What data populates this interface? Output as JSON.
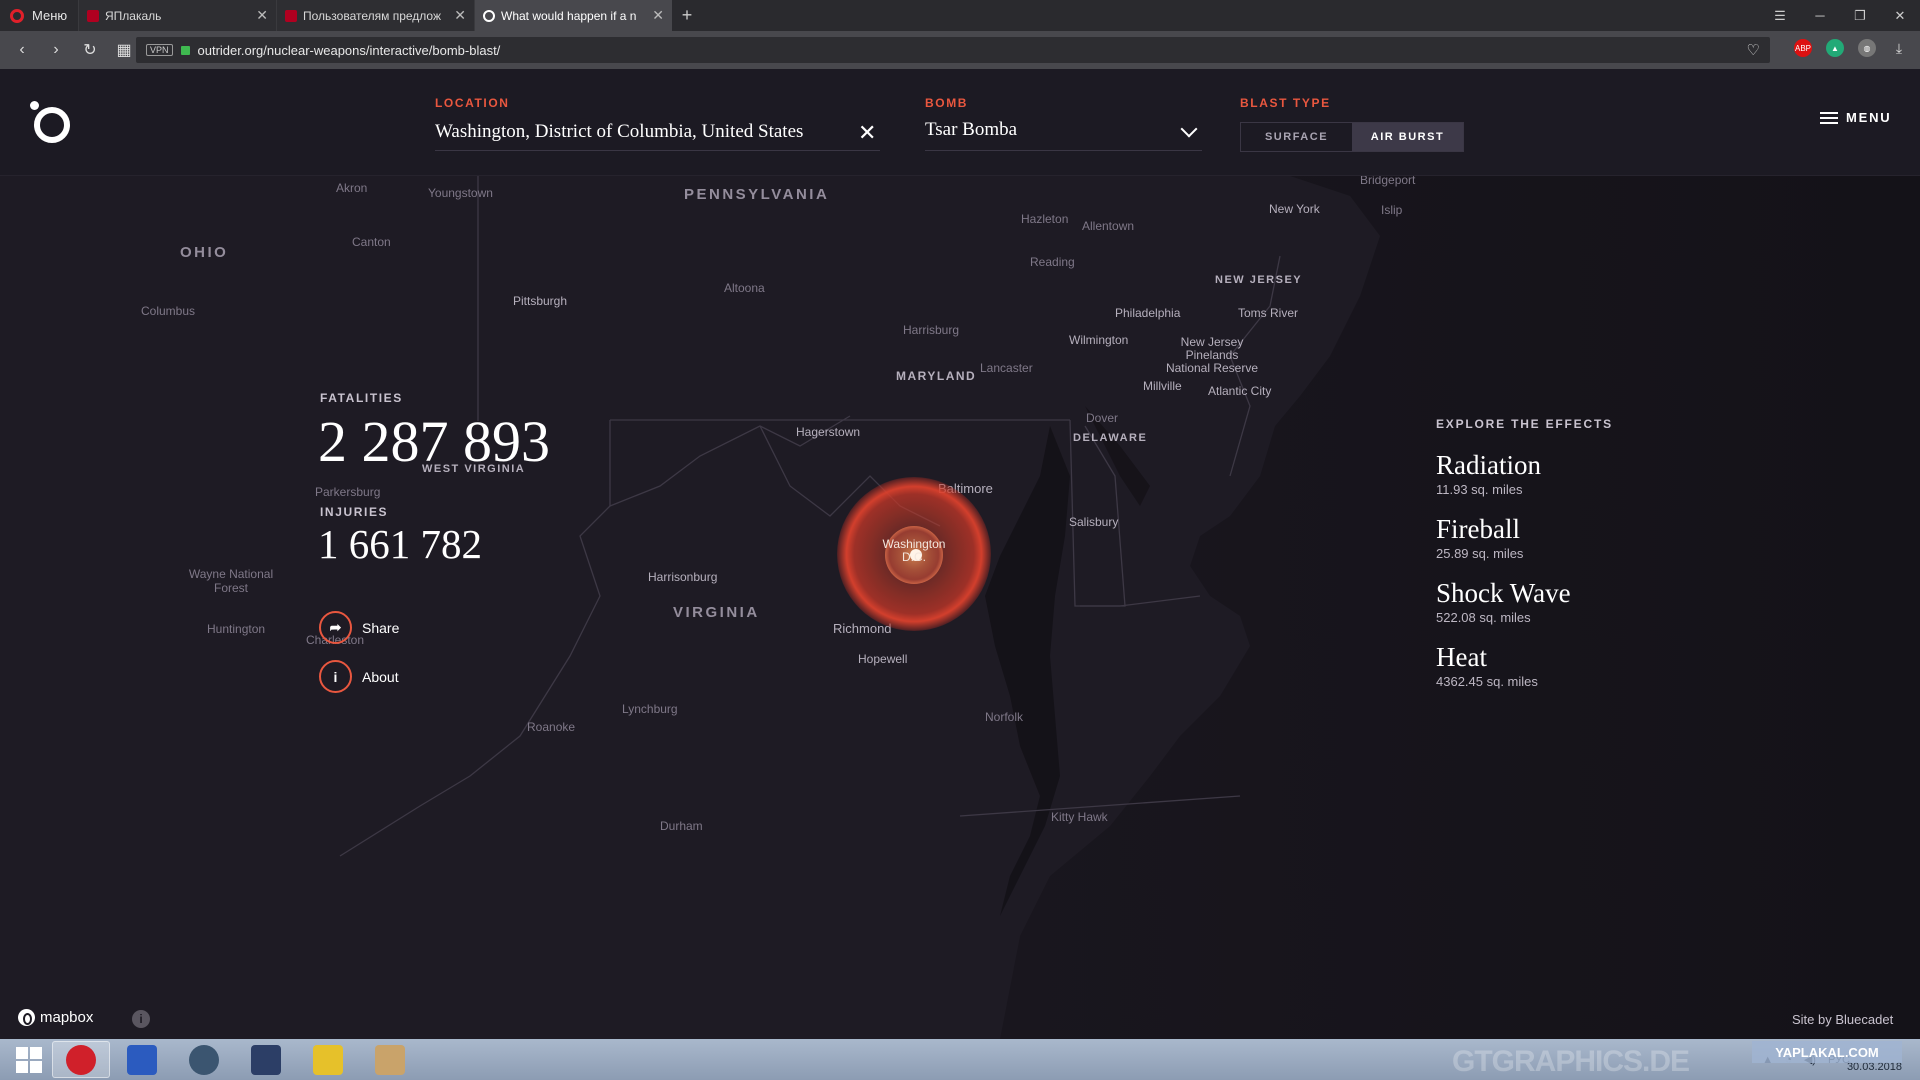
{
  "browser": {
    "menu_label": "Меню",
    "tabs": [
      {
        "title": "ЯПлакаль"
      },
      {
        "title": "Пользователям предлож"
      },
      {
        "title": "What would happen if a n"
      }
    ],
    "url": "outrider.org/nuclear-weapons/interactive/bomb-blast/",
    "vpn_label": "VPN"
  },
  "header": {
    "location_label": "LOCATION",
    "location_value": "Washington, District of Columbia, United States",
    "bomb_label": "BOMB",
    "bomb_value": "Tsar Bomba",
    "blast_type_label": "BLAST TYPE",
    "blast_surface": "SURFACE",
    "blast_air": "AIR BURST",
    "selected_blast_type": "AIR BURST",
    "menu_label": "MENU"
  },
  "stats": {
    "fatalities_label": "FATALITIES",
    "fatalities_value": "2 287 893",
    "injuries_label": "INJURIES",
    "injuries_value": "1 661 782",
    "share_label": "Share",
    "about_label": "About"
  },
  "effects": {
    "title": "EXPLORE THE EFFECTS",
    "items": [
      {
        "name": "Radiation",
        "area": "11.93 sq. miles"
      },
      {
        "name": "Fireball",
        "area": "25.89 sq. miles"
      },
      {
        "name": "Shock Wave",
        "area": "522.08 sq. miles"
      },
      {
        "name": "Heat",
        "area": "4362.45 sq. miles"
      }
    ]
  },
  "map": {
    "states": [
      "PENNSYLVANIA",
      "OHIO",
      "MARYLAND",
      "WEST VIRGINIA",
      "VIRGINIA",
      "NEW JERSEY",
      "DELAWARE"
    ],
    "places": [
      "Youngstown",
      "Akron",
      "Canton",
      "Pittsburgh",
      "Columbus",
      "Parkersburg",
      "Wayne National Forest",
      "Huntington",
      "Charleston",
      "Altoona",
      "Harrisburg",
      "Lancaster",
      "Hagerstown",
      "Baltimore",
      "Harrisonburg",
      "Lynchburg",
      "Roanoke",
      "Richmond",
      "Hopewell",
      "Norfolk",
      "Hazleton",
      "Allentown",
      "Reading",
      "Philadelphia",
      "Wilmington",
      "Dover",
      "Salisbury",
      "New York",
      "Islip",
      "Bridgeport",
      "Toms River",
      "New Jersey Pinelands National Reserve",
      "Millville",
      "Atlantic City",
      "Kitty Hawk",
      "Durham"
    ],
    "target_city": "Washington D.C.",
    "attribution": "mapbox",
    "credit": "Site by Bluecadet"
  },
  "taskbar": {
    "tray_lang": "РУС",
    "date": "30.03.2018"
  },
  "watermarks": {
    "gt": "GTGRAPHICS.DE",
    "yap": "YAPLAKAL.COM"
  }
}
